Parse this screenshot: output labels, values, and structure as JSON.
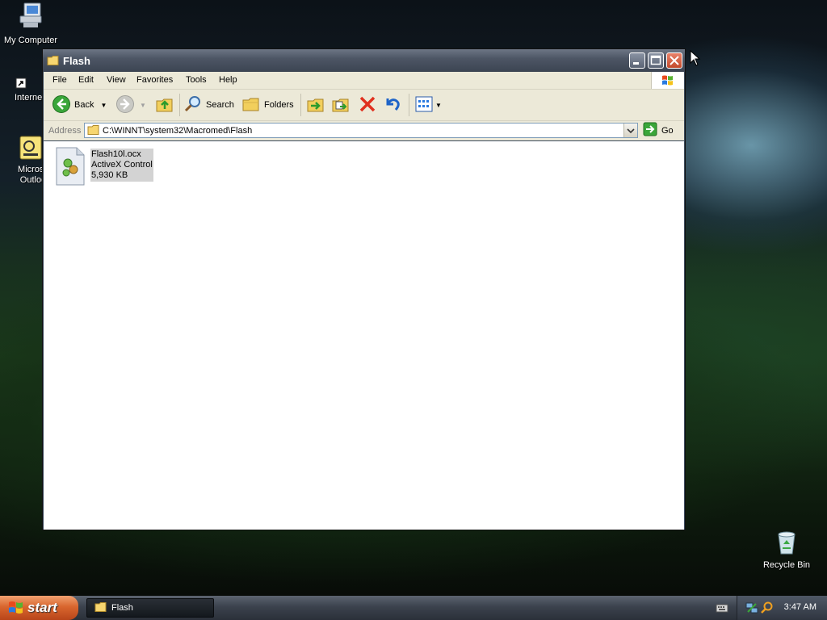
{
  "desktop": {
    "icons": [
      {
        "label": "My Computer"
      },
      {
        "label": "Interne"
      },
      {
        "label": "Microsc\nOutloo"
      },
      {
        "label": "Recycle Bin"
      }
    ]
  },
  "window": {
    "title": "Flash",
    "menu": [
      "File",
      "Edit",
      "View",
      "Favorites",
      "Tools",
      "Help"
    ],
    "toolbar": {
      "back_label": "Back",
      "search_label": "Search",
      "folders_label": "Folders"
    },
    "address": {
      "label": "Address",
      "value": "C:\\WINNT\\system32\\Macromed\\Flash",
      "go_label": "Go"
    },
    "files": [
      {
        "name": "Flash10l.ocx",
        "type": "ActiveX Control",
        "size": "5,930 KB"
      }
    ]
  },
  "taskbar": {
    "start_label": "start",
    "tasks": [
      {
        "label": "Flash"
      }
    ],
    "clock": "3:47 AM"
  }
}
